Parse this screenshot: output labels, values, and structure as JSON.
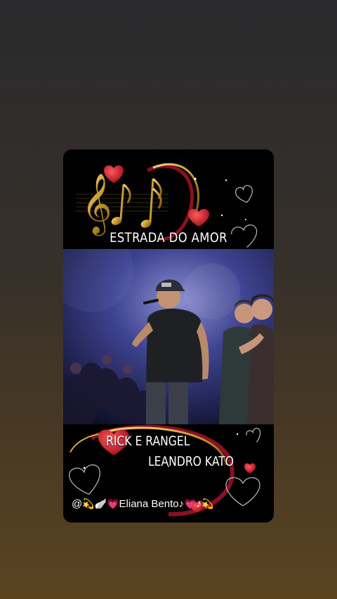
{
  "story": {
    "song_title": "ESTRADA DO AMOR",
    "artist_line_1": "RICK E RANGEL",
    "artist_line_2": "LEANDRO KATO",
    "credit": {
      "at": "@",
      "star": "💫",
      "wing": "🪽",
      "heart": "💗",
      "name": "Eliana Bento",
      "note": "♪",
      "heart2": "💗",
      "note2": "♪",
      "star2": "💫"
    }
  },
  "icons": [
    "treble-clef-icon",
    "music-note-icon",
    "heart-icon",
    "sparkle-icon"
  ],
  "colors": {
    "background_top": "#2a2a2c",
    "background_bottom": "#5a4420",
    "card": "#000000",
    "gold": "#d4a437",
    "heart_red": "#c8102e",
    "stage_blue": "#3b3f86"
  }
}
